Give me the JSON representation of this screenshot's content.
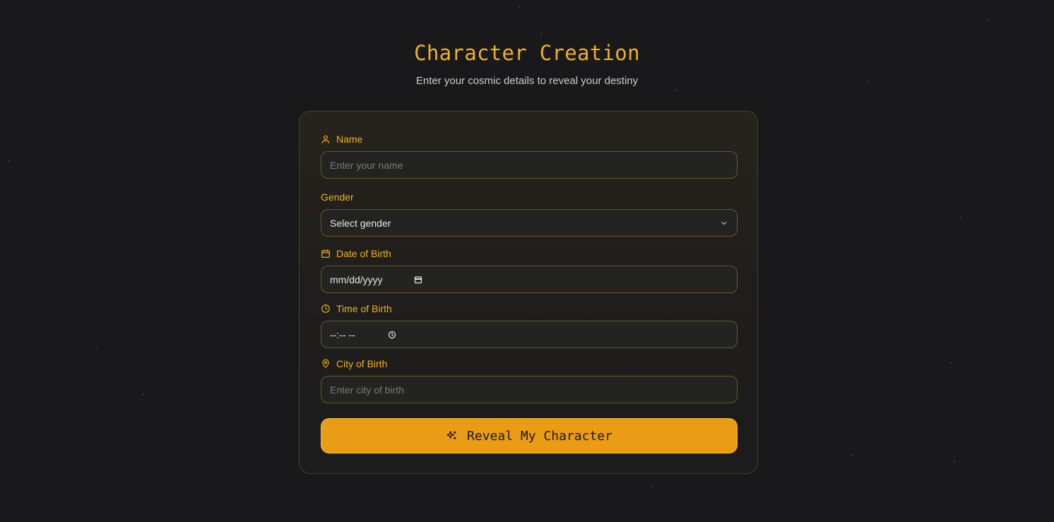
{
  "header": {
    "title": "Character Creation",
    "subtitle": "Enter your cosmic details to reveal your destiny"
  },
  "form": {
    "name": {
      "label": "Name",
      "placeholder": "Enter your name",
      "icon": "user-icon"
    },
    "gender": {
      "label": "Gender",
      "value": "Select gender",
      "icon": "chevron-down-icon"
    },
    "dob": {
      "label": "Date of Birth",
      "value": "mm/dd/yyyy",
      "icon": "calendar-icon"
    },
    "tob": {
      "label": "Time of Birth",
      "value": "--:-- --",
      "icon": "clock-icon"
    },
    "city": {
      "label": "City of Birth",
      "placeholder": "Enter city of birth",
      "icon": "map-pin-icon"
    },
    "submit": {
      "label": "Reveal My Character",
      "icon": "sparkles-icon"
    }
  },
  "colors": {
    "background": "#19191b",
    "accent": "#f0b020",
    "button": "#e99c14",
    "field_border": "#6d5622"
  }
}
